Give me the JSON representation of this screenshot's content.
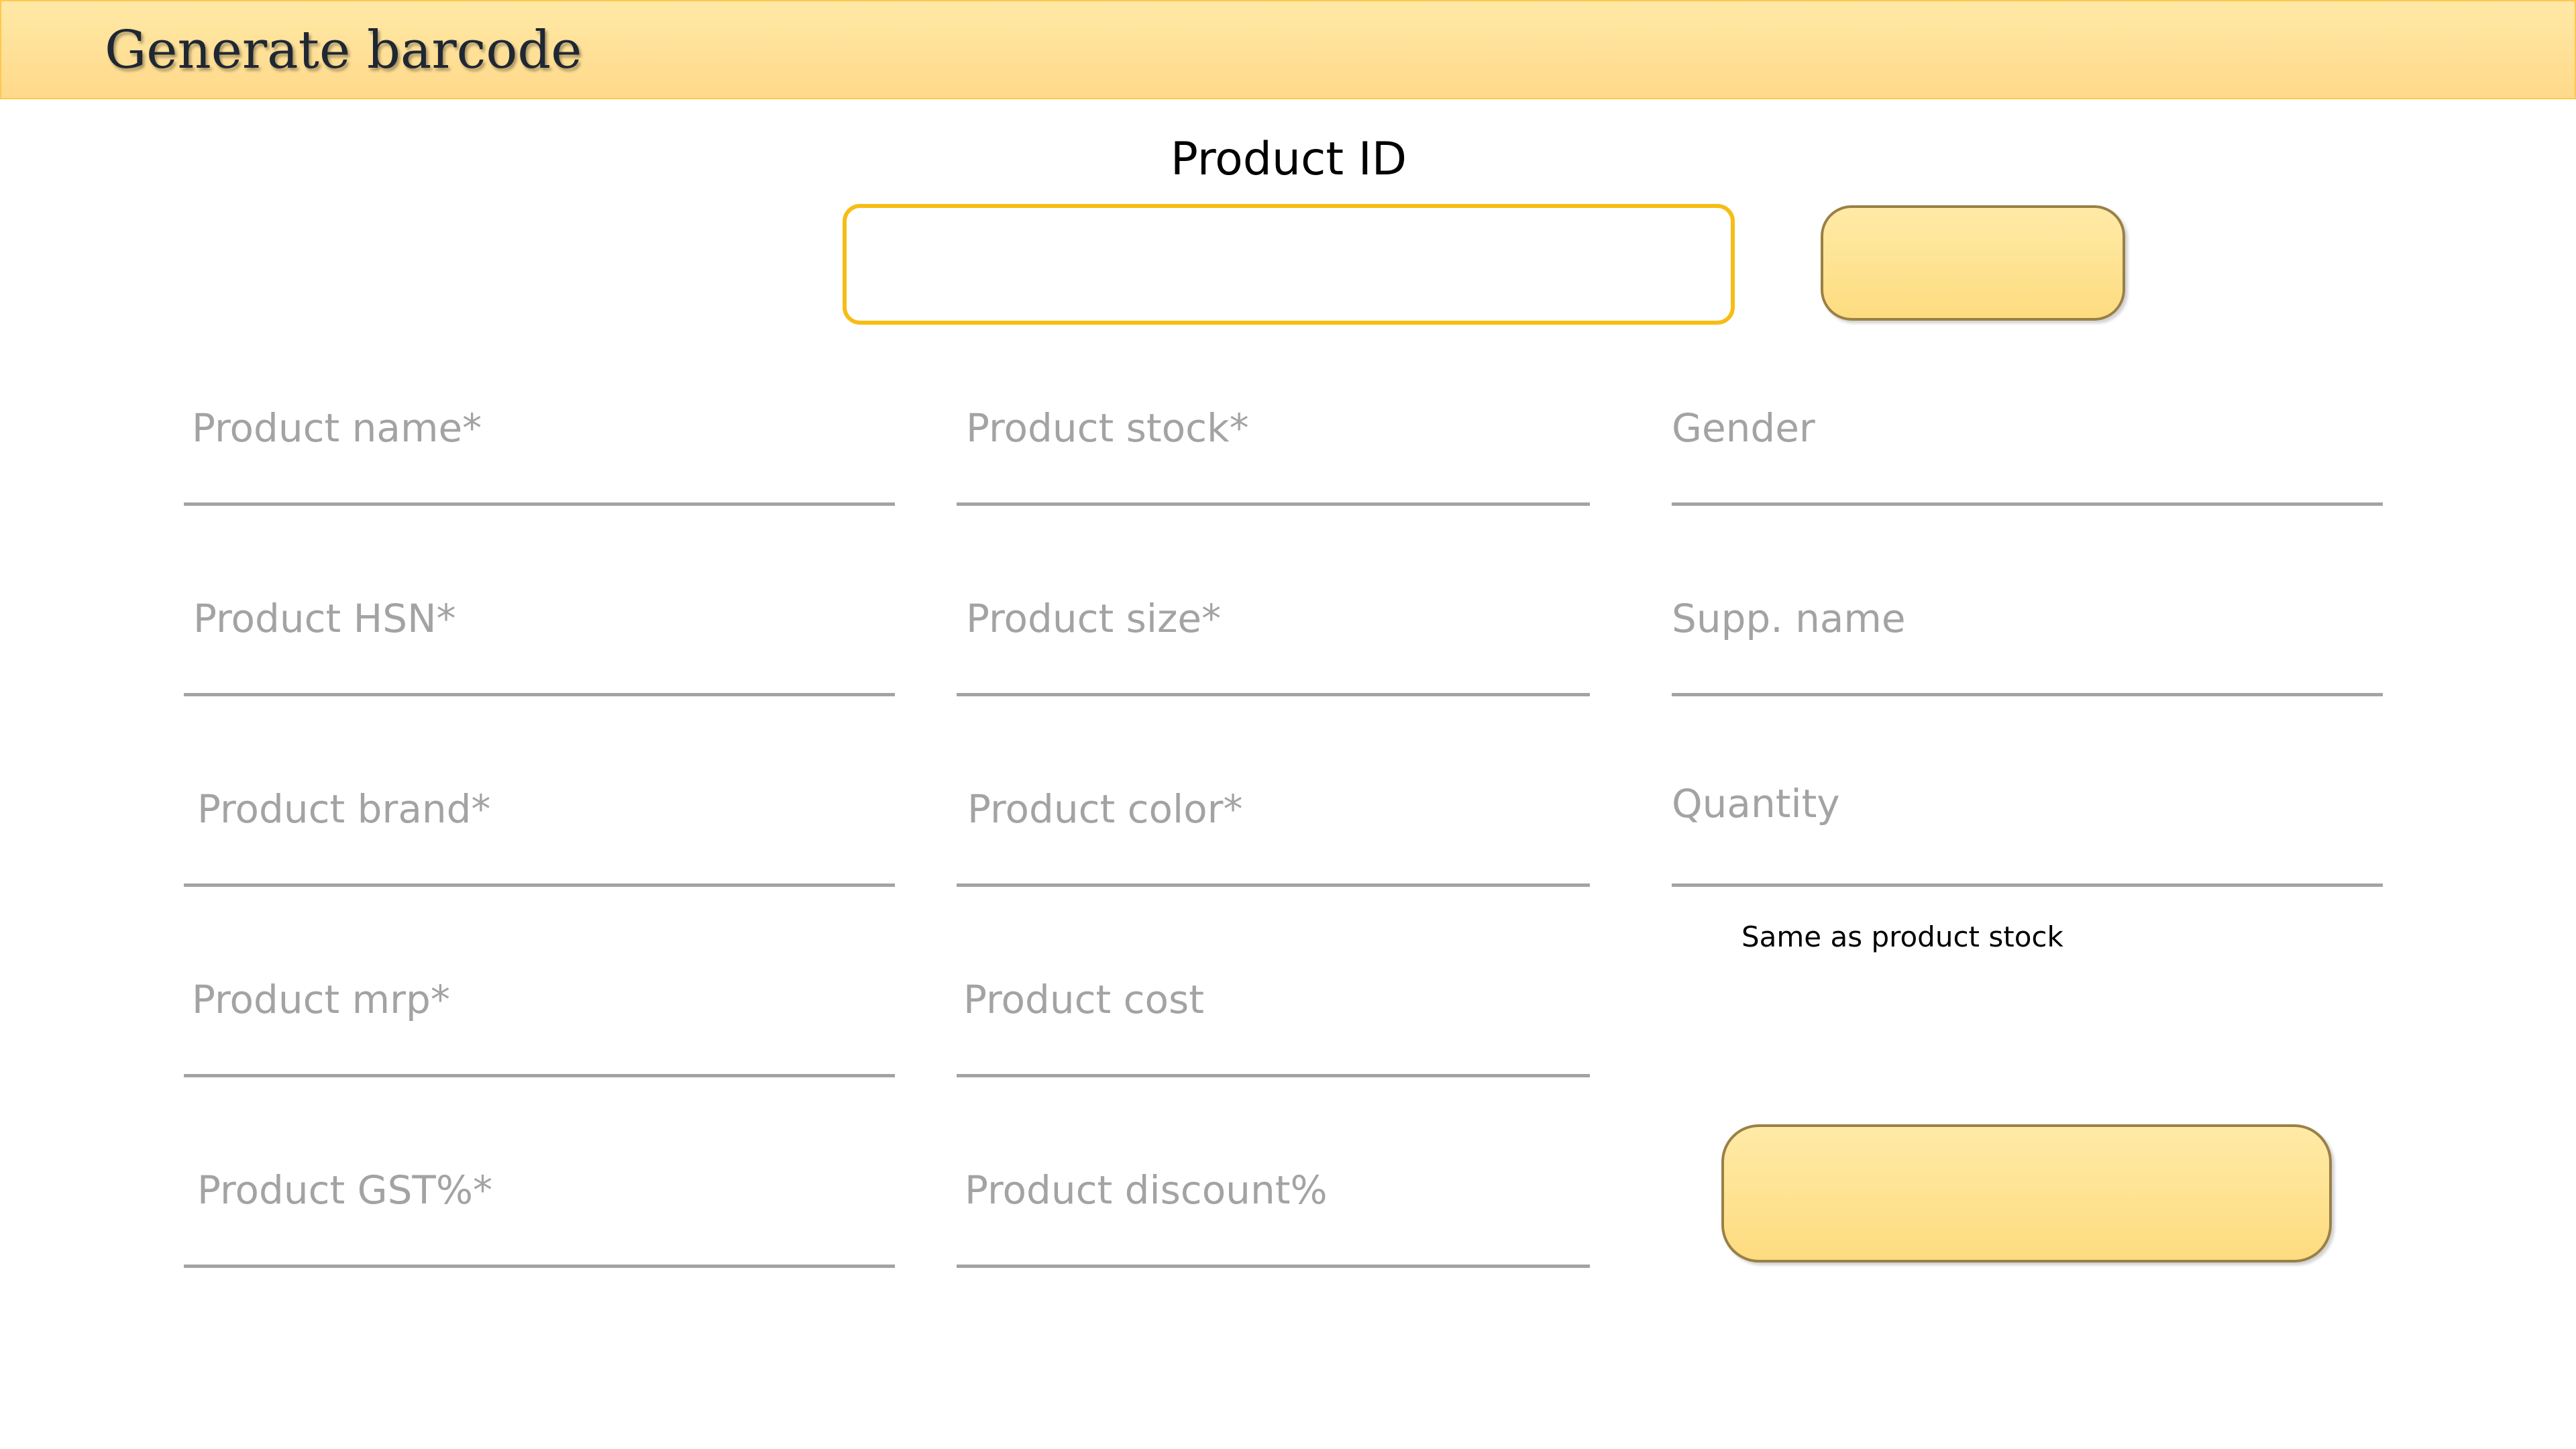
{
  "header": {
    "title": "Generate barcode"
  },
  "product_id": {
    "label": "Product ID",
    "value": ""
  },
  "fields": {
    "product_name": "Product name*",
    "product_stock": "Product stock*",
    "gender": "Gender",
    "product_hsn": "Product HSN*",
    "product_size": "Product size*",
    "supp_name": "Supp. name",
    "product_brand": "Product brand*",
    "product_color": "Product color*",
    "quantity": "Quantity",
    "product_mrp": "Product mrp*",
    "product_cost": "Product cost",
    "product_gst": "Product GST%*",
    "product_discount": "Product discount%"
  },
  "quantity_hint": "Same as product stock",
  "buttons": {
    "search_label": "",
    "generate_label": ""
  },
  "colors": {
    "header_bg": "#ffdd90",
    "accent_border": "#f6bd15",
    "button_fill": "#fde08a",
    "field_text": "#a3a3a3"
  }
}
